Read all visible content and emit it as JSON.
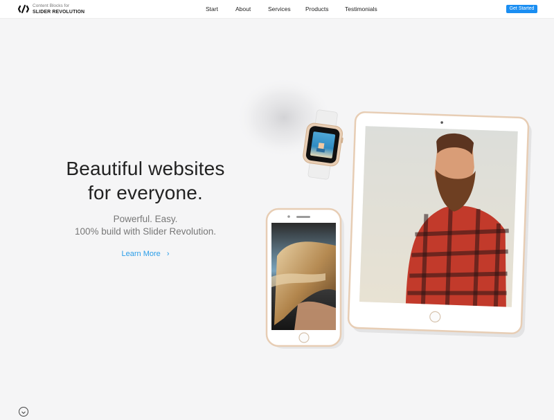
{
  "header": {
    "logo": {
      "line1": "Content Blocks for",
      "line2": "SLIDER REVOLUTION",
      "icon": "slash-logo-icon"
    },
    "nav": [
      {
        "label": "Start"
      },
      {
        "label": "About"
      },
      {
        "label": "Services"
      },
      {
        "label": "Products"
      },
      {
        "label": "Testimonials"
      }
    ],
    "cta_label": "Get Started"
  },
  "hero": {
    "title_line1": "Beautiful websites",
    "title_line2": "for everyone.",
    "subtitle_line1": "Powerful. Easy.",
    "subtitle_line2": "100% build with Slider Revolution.",
    "learn_more_label": "Learn More",
    "learn_more_icon": "chevron-right-icon"
  },
  "scroll_icon": "chevron-down-icon",
  "colors": {
    "accent": "#1a8ef2",
    "link": "#2a9de8",
    "background": "#f5f5f6",
    "device_gold": "#e7cdb4"
  }
}
